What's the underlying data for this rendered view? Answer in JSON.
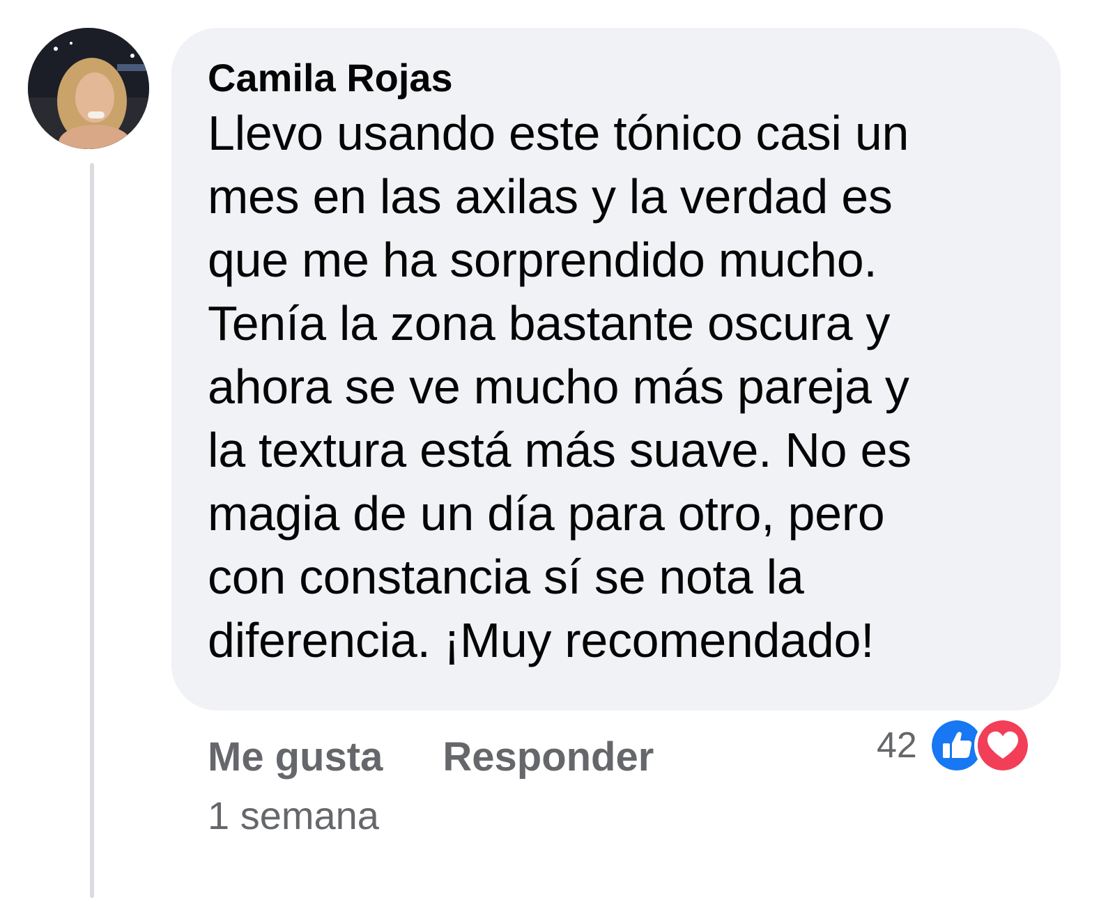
{
  "comment": {
    "author": "Camila Rojas",
    "text": "Llevo usando este tónico casi un\nmes en las axilas y la verdad es\nque me ha sorprendido mucho.\nTenía la zona bastante oscura y\nahora se ve mucho más pareja y\nla textura está más suave. No es\nmagia de un día para otro, pero\ncon constancia sí se nota la\ndiferencia. ¡Muy recomendado!",
    "like_label": "Me gusta",
    "reply_label": "Responder",
    "timestamp": "1 semana",
    "reaction_count": "42",
    "reactions": [
      "like-icon",
      "love-icon"
    ]
  },
  "colors": {
    "bubble": "#f0f2f5",
    "text": "#050505",
    "meta": "#65676b",
    "like": "#1877f2",
    "love": "#f33e58"
  }
}
